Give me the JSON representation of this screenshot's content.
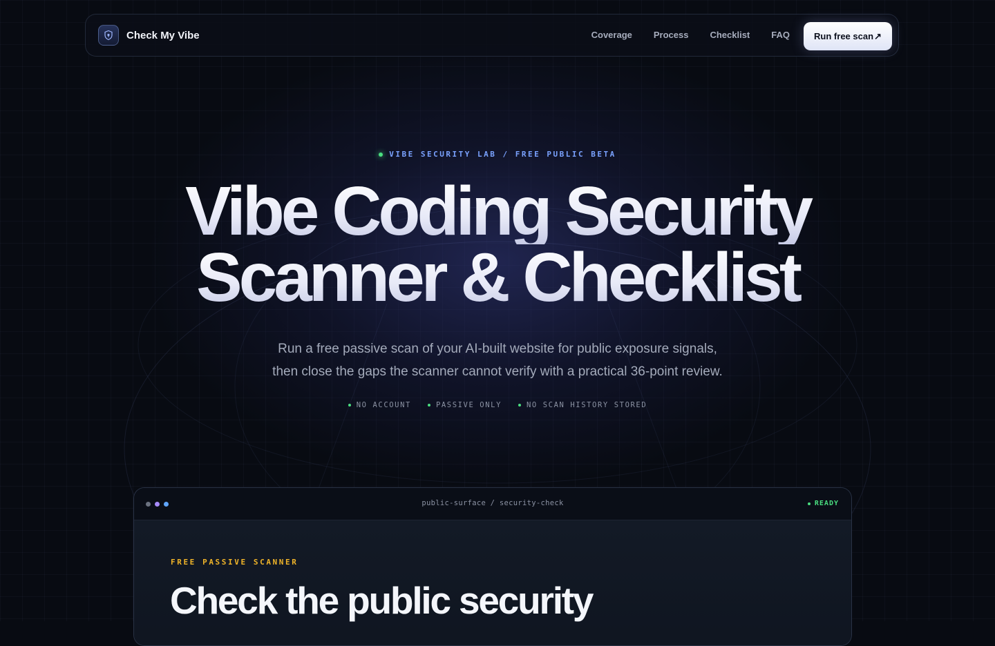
{
  "brand": {
    "name": "Check My Vibe",
    "logo_icon": "shield-lock-icon"
  },
  "nav": {
    "links": [
      "Coverage",
      "Process",
      "Checklist",
      "FAQ"
    ],
    "cta": "Run free scan",
    "cta_icon": "↗"
  },
  "hero": {
    "eyebrow": "VIBE SECURITY LAB / FREE PUBLIC BETA",
    "headline_line1": "Vibe Coding Security",
    "headline_line2": "Scanner & Checklist",
    "subtitle_line1": "Run a free passive scan of your AI-built website for public exposure signals,",
    "subtitle_line2": "then close the gaps the scanner cannot verify with a practical 36-point review.",
    "features": [
      "NO ACCOUNT",
      "PASSIVE ONLY",
      "NO SCAN HISTORY STORED"
    ]
  },
  "scanner": {
    "window_title": "public-surface / security-check",
    "status": "READY",
    "label": "FREE PASSIVE SCANNER",
    "heading": "Check the public security"
  },
  "colors": {
    "background": "#080b12",
    "accent_blue": "#7aa2ff",
    "accent_green": "#4ade80",
    "accent_amber": "#f0b429",
    "window_dots": [
      "#6b7280",
      "#a78bfa",
      "#60a5fa"
    ]
  }
}
